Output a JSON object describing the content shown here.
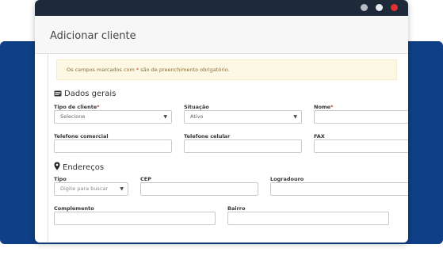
{
  "window": {
    "title": "Adicionar cliente",
    "controls": [
      "minimize",
      "maximize",
      "close"
    ]
  },
  "notice": {
    "text_before": "Os campos marcados com ",
    "asterisk": "*",
    "text_after": " são de preenchimento obrigatório."
  },
  "sections": {
    "general": {
      "title": "Dados gerais",
      "icon": "id-card-icon"
    },
    "addresses": {
      "title": "Endereços",
      "icon": "map-marker-icon"
    }
  },
  "general": {
    "client_type": {
      "label": "Tipo de cliente",
      "required": "*",
      "value": "Selecione"
    },
    "status": {
      "label": "Situação",
      "value": "Ativo"
    },
    "name": {
      "label": "Nome",
      "required": "*",
      "value": ""
    },
    "phone_commercial": {
      "label": "Telefone comercial",
      "value": ""
    },
    "phone_mobile": {
      "label": "Telefone celular",
      "value": ""
    },
    "fax": {
      "label": "FAX",
      "value": ""
    }
  },
  "address": {
    "type": {
      "label": "Tipo",
      "placeholder": "Digite para buscar"
    },
    "cep": {
      "label": "CEP",
      "value": ""
    },
    "street": {
      "label": "Logradouro",
      "value": ""
    },
    "complement": {
      "label": "Complemento",
      "value": ""
    },
    "district": {
      "label": "Bairro",
      "value": ""
    }
  },
  "colors": {
    "brand_blue": "#0f3f87",
    "titlebar": "#1e2a3a",
    "close_dot": "#e03030",
    "notice_bg": "#fcf8e3",
    "required": "#c9302c"
  }
}
